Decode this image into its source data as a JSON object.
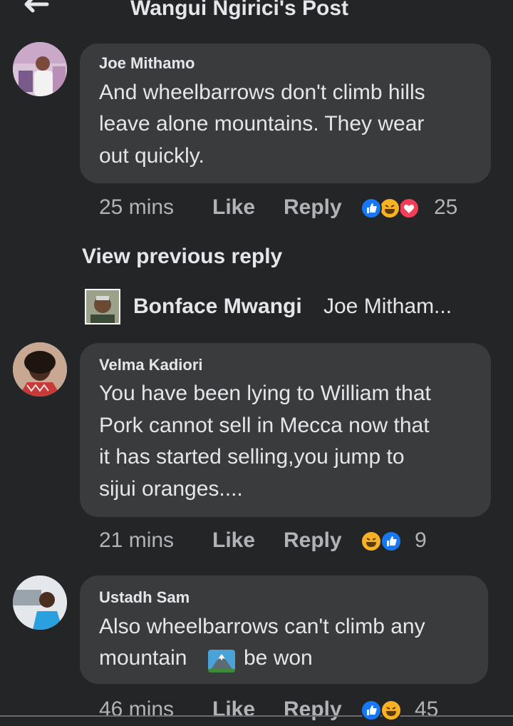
{
  "header": {
    "title": "Wangui Ngirici's Post",
    "back_icon": "back-arrow-icon"
  },
  "comments": [
    {
      "author": "Joe Mithamo",
      "lines": [
        "And wheelbarrows don't climb hills",
        "leave alone mountains. They wear",
        "out quickly."
      ],
      "time": "25 mins",
      "like_label": "Like",
      "reply_label": "Reply",
      "reactions": [
        "like",
        "haha",
        "love"
      ],
      "reaction_count": "25"
    },
    {
      "author": "Velma Kadiori",
      "lines": [
        "You have been lying to William that",
        "Pork cannot sell in Mecca now that",
        "it has started selling,you jump to",
        "sijui oranges...."
      ],
      "time": "21 mins",
      "like_label": "Like",
      "reply_label": "Reply",
      "reactions": [
        "haha",
        "like"
      ],
      "reaction_count": "9"
    },
    {
      "author": "Ustadh Sam",
      "lines": [
        "Also wheelbarrows can't climb any",
        "mountain",
        "be won"
      ],
      "time": "46 mins",
      "like_label": "Like",
      "reply_label": "Reply",
      "reactions": [
        "like",
        "haha"
      ],
      "reaction_count": "45"
    }
  ],
  "view_previous": "View previous reply",
  "reply_preview": {
    "author": "Bonface Mwangi",
    "snippet": "Joe Mitham..."
  },
  "colors": {
    "background": "#242526",
    "bubble": "#3a3b3c",
    "text": "#e4e6eb",
    "meta": "#b0b3b8",
    "like": "#1877f2",
    "love": "#f33e58",
    "haha": "#f7b125"
  }
}
